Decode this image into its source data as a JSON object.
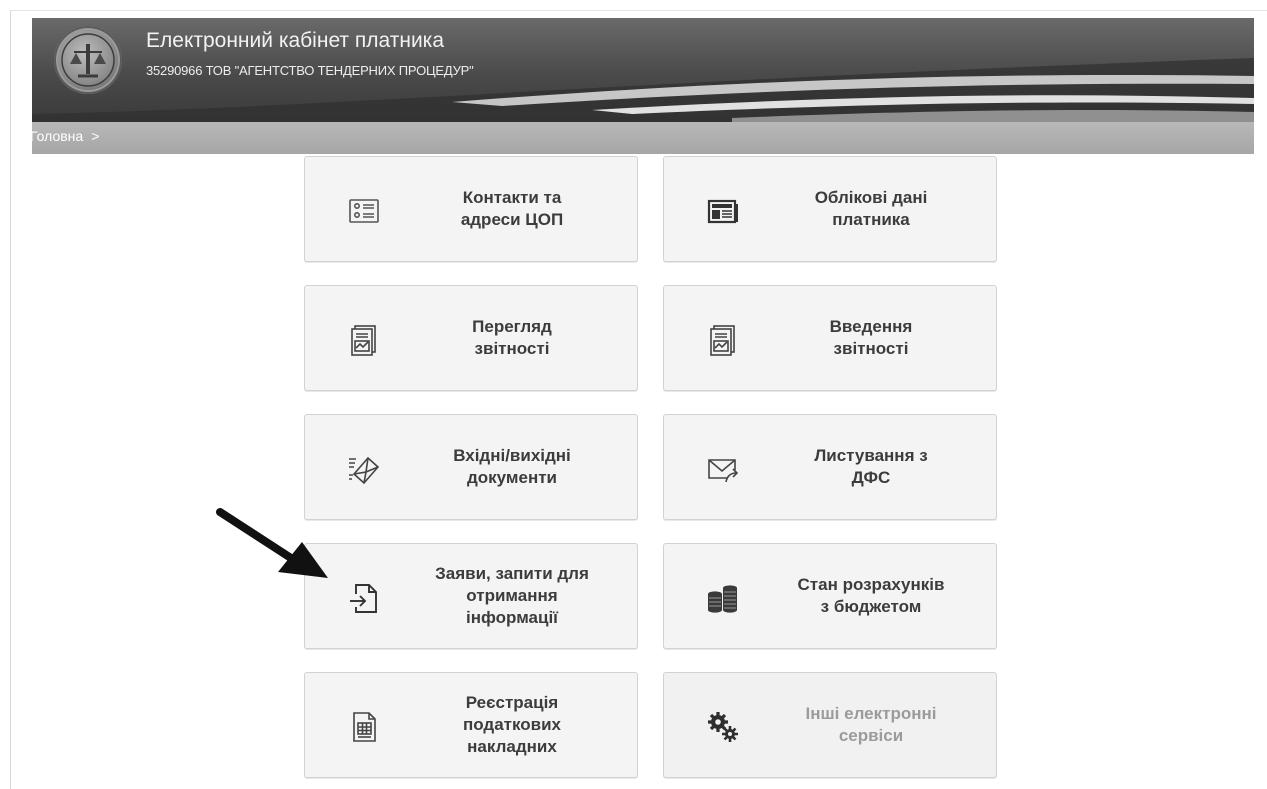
{
  "header": {
    "title": "Електронний кабінет платника",
    "subtitle": "35290966 ТОВ \"АГЕНТСТВО ТЕНДЕРНИХ ПРОЦЕДУР\""
  },
  "breadcrumb": {
    "home": "Головна",
    "separator": ">"
  },
  "tiles": [
    {
      "label": "Контакти та\nадреси ЦОП",
      "icon": "contact-card-icon"
    },
    {
      "label": "Облікові дані\nплатника",
      "icon": "newspaper-icon"
    },
    {
      "label": "Перегляд\nзвітності",
      "icon": "report-chart-icon"
    },
    {
      "label": "Введення\nзвітності",
      "icon": "report-chart-icon"
    },
    {
      "label": "Вхідні/вихідні\nдокументи",
      "icon": "envelope-fast-icon"
    },
    {
      "label": "Листування з\nДФС",
      "icon": "envelope-send-icon"
    },
    {
      "label": "Заяви, запити для\nотримання\nінформації",
      "icon": "file-import-icon"
    },
    {
      "label": "Стан розрахунків\nз бюджетом",
      "icon": "coins-stack-icon"
    },
    {
      "label": "Реєстрація\nподаткових\nнакладних",
      "icon": "invoice-table-icon"
    },
    {
      "label": "Інші електронні\nсервіси",
      "icon": "gears-icon",
      "disabled": true
    }
  ],
  "colors": {
    "header_dark": "#3a3a3a",
    "breadcrumb_bar": "#aaaaaa",
    "tile_bg": "#f4f4f4",
    "tile_border": "#d2d2d2",
    "disabled_text": "#9b9b9b"
  }
}
